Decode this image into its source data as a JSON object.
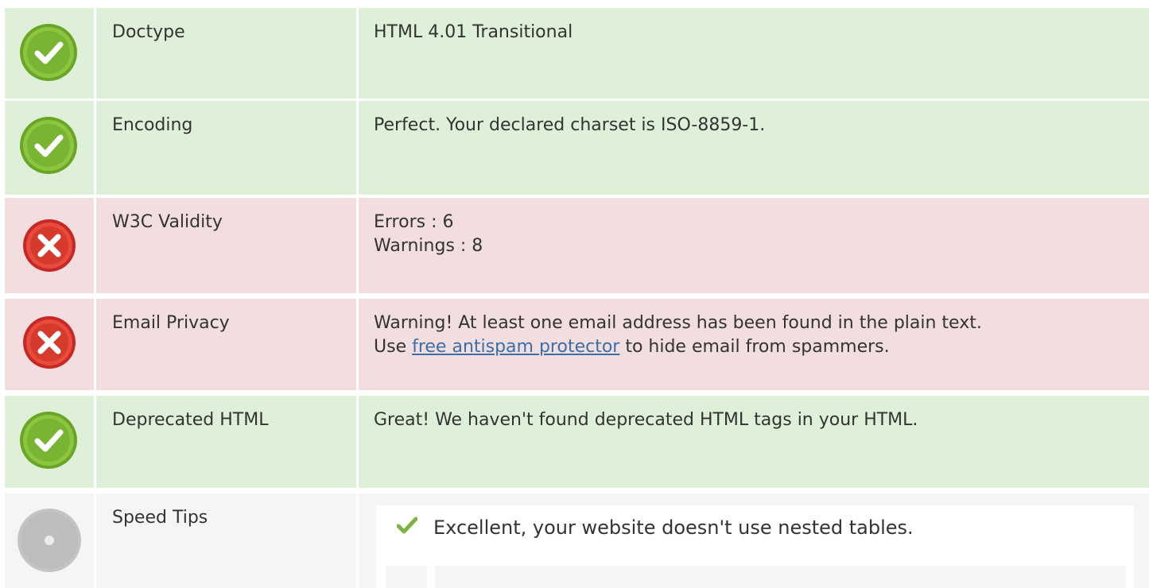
{
  "colors": {
    "pass_bg": "#dff0d8",
    "fail_bg": "#f2dede",
    "info_bg": "#f5f5f5",
    "pass_icon": "#8bc34a",
    "fail_icon": "#e53935",
    "info_icon": "#bdbdbd",
    "link": "#3a6ea8"
  },
  "rows": [
    {
      "status": "pass",
      "icon": "check-circle-icon",
      "label": "Doctype",
      "value_lines": [
        "HTML 4.01 Transitional"
      ]
    },
    {
      "status": "pass",
      "icon": "check-circle-icon",
      "label": "Encoding",
      "value_lines": [
        "Perfect. Your declared charset is ISO-8859-1."
      ]
    },
    {
      "status": "fail",
      "icon": "cross-circle-icon",
      "label": "W3C Validity",
      "value_lines": [
        "Errors : 6",
        "Warnings : 8"
      ]
    },
    {
      "status": "fail",
      "icon": "cross-circle-icon",
      "label": "Email Privacy",
      "value_lines": [
        "Warning! At least one email address has been found in the plain text."
      ],
      "link_prefix": "Use ",
      "link_text": "free antispam protector",
      "link_suffix": " to hide email from spammers."
    },
    {
      "status": "pass",
      "icon": "check-circle-icon",
      "label": "Deprecated HTML",
      "value_lines": [
        "Great! We haven't found deprecated HTML tags in your HTML."
      ]
    },
    {
      "status": "info",
      "icon": "info-circle-icon",
      "label": "Speed Tips",
      "tips": [
        {
          "icon": "checkmark-icon",
          "text": "Excellent, your website doesn't use nested tables."
        }
      ]
    }
  ]
}
